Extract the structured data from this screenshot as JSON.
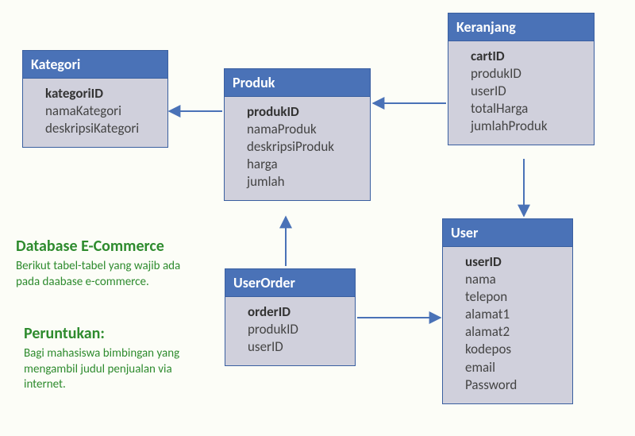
{
  "entities": {
    "kategori": {
      "title": "Kategori",
      "pk": "kategoriID",
      "attrs": [
        "namaKategori",
        "deskripsiKategori"
      ]
    },
    "produk": {
      "title": "Produk",
      "pk": "produkID",
      "attrs": [
        "namaProduk",
        "deskripsiProduk",
        "harga",
        "jumlah"
      ]
    },
    "keranjang": {
      "title": "Keranjang",
      "pk": "cartID",
      "attrs": [
        "produkID",
        "userID",
        "totalHarga",
        "jumlahProduk"
      ]
    },
    "userorder": {
      "title": "UserOrder",
      "pk": "orderID",
      "attrs": [
        "produkID",
        "userID"
      ]
    },
    "user": {
      "title": "User",
      "pk": "userID",
      "attrs": [
        "nama",
        "telepon",
        "alamat1",
        "alamat2",
        "kodepos",
        "email",
        "Password"
      ]
    }
  },
  "text": {
    "heading1": "Database E-Commerce",
    "desc1": "Berikut tabel-tabel yang wajib ada pada daabase e-commerce.",
    "heading2": "Peruntukan:",
    "desc2": "Bagi mahasiswa bimbingan yang mengambil judul penjualan via internet."
  }
}
